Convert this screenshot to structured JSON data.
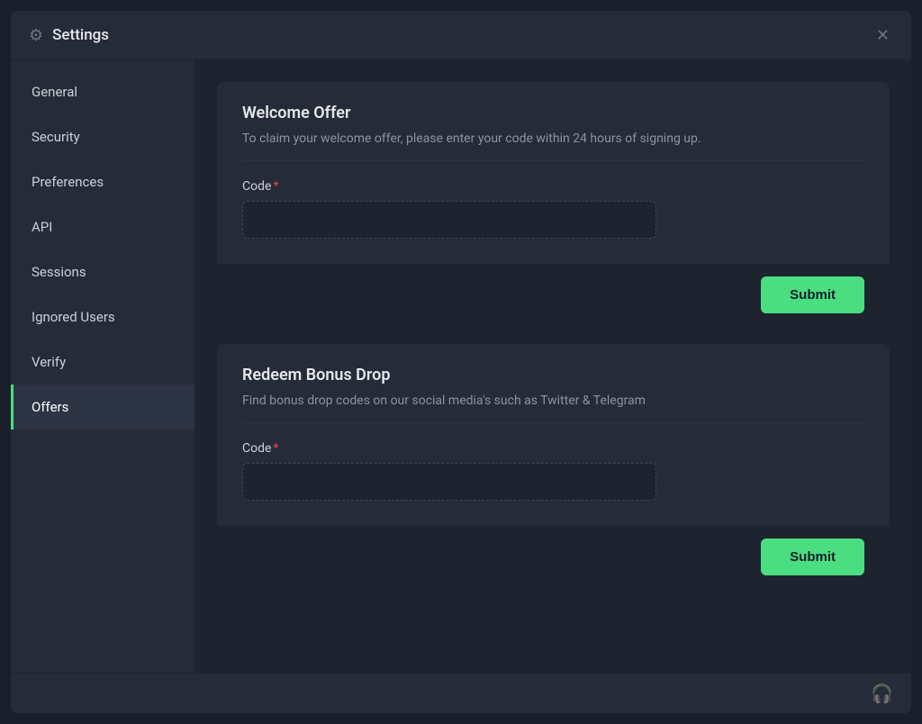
{
  "window": {
    "title": "Settings",
    "gear_icon": "⚙",
    "close_icon": "✕"
  },
  "sidebar": {
    "items": [
      {
        "label": "General",
        "id": "general",
        "active": false
      },
      {
        "label": "Security",
        "id": "security",
        "active": false
      },
      {
        "label": "Preferences",
        "id": "preferences",
        "active": false
      },
      {
        "label": "API",
        "id": "api",
        "active": false
      },
      {
        "label": "Sessions",
        "id": "sessions",
        "active": false
      },
      {
        "label": "Ignored Users",
        "id": "ignored-users",
        "active": false
      },
      {
        "label": "Verify",
        "id": "verify",
        "active": false
      },
      {
        "label": "Offers",
        "id": "offers",
        "active": true
      }
    ]
  },
  "cards": {
    "welcome_offer": {
      "title": "Welcome Offer",
      "description": "To claim your welcome offer, please enter your code within 24 hours of signing up.",
      "code_label": "Code",
      "code_placeholder": "",
      "submit_label": "Submit"
    },
    "bonus_drop": {
      "title": "Redeem Bonus Drop",
      "description": "Find bonus drop codes on our social media's such as Twitter & Telegram",
      "code_label": "Code",
      "code_placeholder": "",
      "submit_label": "Submit"
    }
  },
  "footer": {
    "icon": "🎧"
  }
}
